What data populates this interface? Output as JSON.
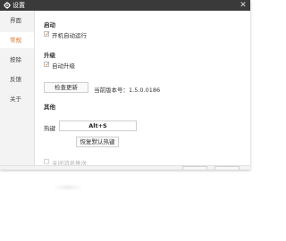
{
  "window": {
    "title": "设置",
    "accent": "#e07020",
    "titlebar_color": "#3a3a3a"
  },
  "sidebar": {
    "items": [
      {
        "label": "界面"
      },
      {
        "label": "常规",
        "active": true
      },
      {
        "label": "按除"
      },
      {
        "label": "反馈"
      },
      {
        "label": "关于"
      }
    ]
  },
  "main": {
    "startup": {
      "title": "启动",
      "autostart_label": "开机自动运行",
      "autostart_checked": true
    },
    "upgrade": {
      "title": "升级",
      "auto_upgrade_label": "自动升级",
      "auto_upgrade_checked": true,
      "check_update_button": "检查更新",
      "version_label": "当前版本号：1.5.0.0186"
    },
    "other": {
      "title": "其他",
      "hotkey_label": "热键",
      "hotkey_value": "Alt+S",
      "restore_hotkey_button": "恢复默认热键",
      "disable_push_label": "关闭消息推送",
      "disable_push_checked": false
    }
  },
  "icons": {
    "title": "gear-icon",
    "close": "close-icon",
    "check": "check-icon"
  }
}
